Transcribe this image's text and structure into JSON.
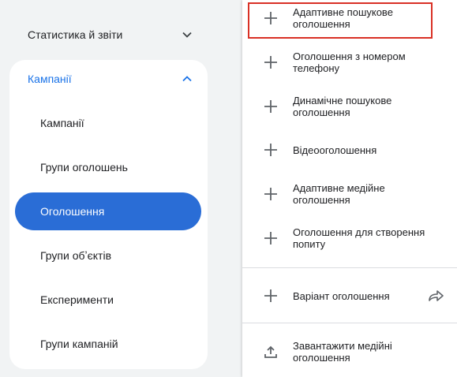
{
  "nav": {
    "header": {
      "label": "Статистика й звіти",
      "icon": "chevron-down-icon"
    },
    "campaigns_section": {
      "label": "Кампанії",
      "icon": "chevron-up-icon",
      "items": [
        {
          "label": "Кампанії",
          "active": false
        },
        {
          "label": "Групи оголошень",
          "active": false
        },
        {
          "label": "Оголошення",
          "active": true
        },
        {
          "label": "Групи обʼєктів",
          "active": false
        },
        {
          "label": "Експерименти",
          "active": false
        },
        {
          "label": "Групи кампаній",
          "active": false
        }
      ]
    }
  },
  "menu": {
    "items": [
      {
        "label": "Адаптивне пошукове оголошення",
        "icon": "plus-icon",
        "highlighted": true
      },
      {
        "label": "Оголошення з номером телефону",
        "icon": "plus-icon"
      },
      {
        "label": "Динамічне пошукове оголошення",
        "icon": "plus-icon"
      },
      {
        "label": "Відеооголошення",
        "icon": "plus-icon"
      },
      {
        "label": "Адаптивне медійне оголошення",
        "icon": "plus-icon"
      },
      {
        "label": "Оголошення для створення попиту",
        "icon": "plus-icon"
      }
    ],
    "variant": {
      "label": "Варіант оголошення",
      "icon": "plus-icon",
      "trailing_icon": "share-arrow-icon"
    },
    "upload": {
      "label": "Завантажити медійні оголошення",
      "icon": "upload-icon"
    }
  },
  "colors": {
    "accent": "#1a73e8",
    "active_bg": "#2a6dd6",
    "highlight_border": "#d93025",
    "background": "#f1f3f4"
  }
}
